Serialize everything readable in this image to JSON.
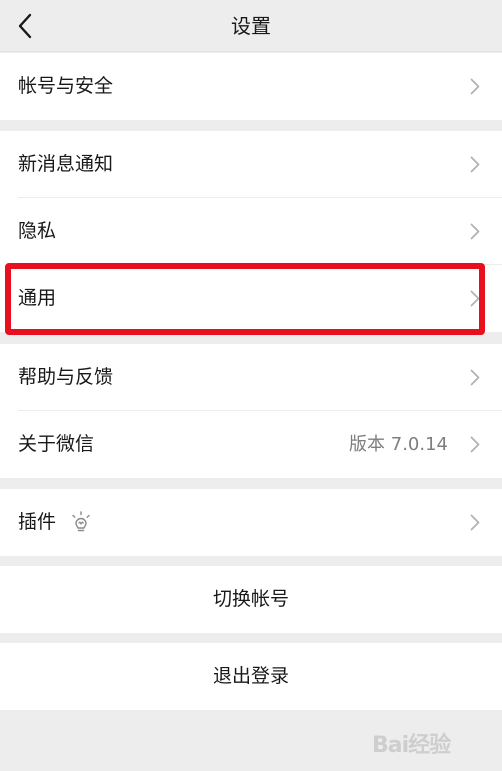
{
  "header": {
    "title": "设置",
    "back_icon": "chevron-left-icon"
  },
  "groups": [
    {
      "items": [
        {
          "label": "帐号与安全"
        }
      ]
    },
    {
      "items": [
        {
          "label": "新消息通知"
        },
        {
          "label": "隐私"
        },
        {
          "label": "通用"
        }
      ]
    },
    {
      "items": [
        {
          "label": "帮助与反馈"
        },
        {
          "label": "关于微信",
          "value": "版本 7.0.14"
        }
      ]
    },
    {
      "items": [
        {
          "label": "插件",
          "icon": "lightbulb-icon"
        }
      ]
    }
  ],
  "actions": {
    "switch_account": "切换帐号",
    "logout": "退出登录"
  },
  "highlight": {
    "target": "通用",
    "color": "#e8101f"
  },
  "watermark": {
    "text": "Bai经验"
  },
  "colors": {
    "background": "#ededed",
    "cell": "#ffffff",
    "text": "#191919",
    "secondary_text": "#7f7f7f",
    "chevron": "#b2b2b2",
    "highlight_border": "#e8101f"
  }
}
